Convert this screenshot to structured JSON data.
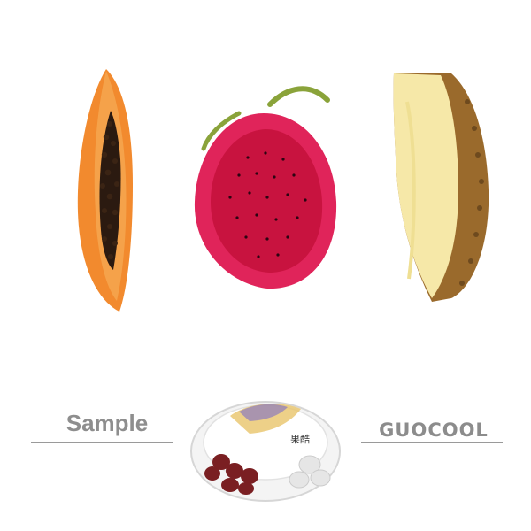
{
  "left_caption": "Sample",
  "brand_caption": "GUOCOOL",
  "package": {
    "lid_text": "果酷"
  },
  "colors": {
    "papaya_flesh": "#f28a2e",
    "dragonfruit_skin": "#e0245a",
    "dragonfruit_flesh": "#c8133f",
    "pineapple_flesh": "#f6e8a8",
    "pineapple_rind": "#9a6a2c",
    "caption_gray": "#8e8e8e"
  }
}
